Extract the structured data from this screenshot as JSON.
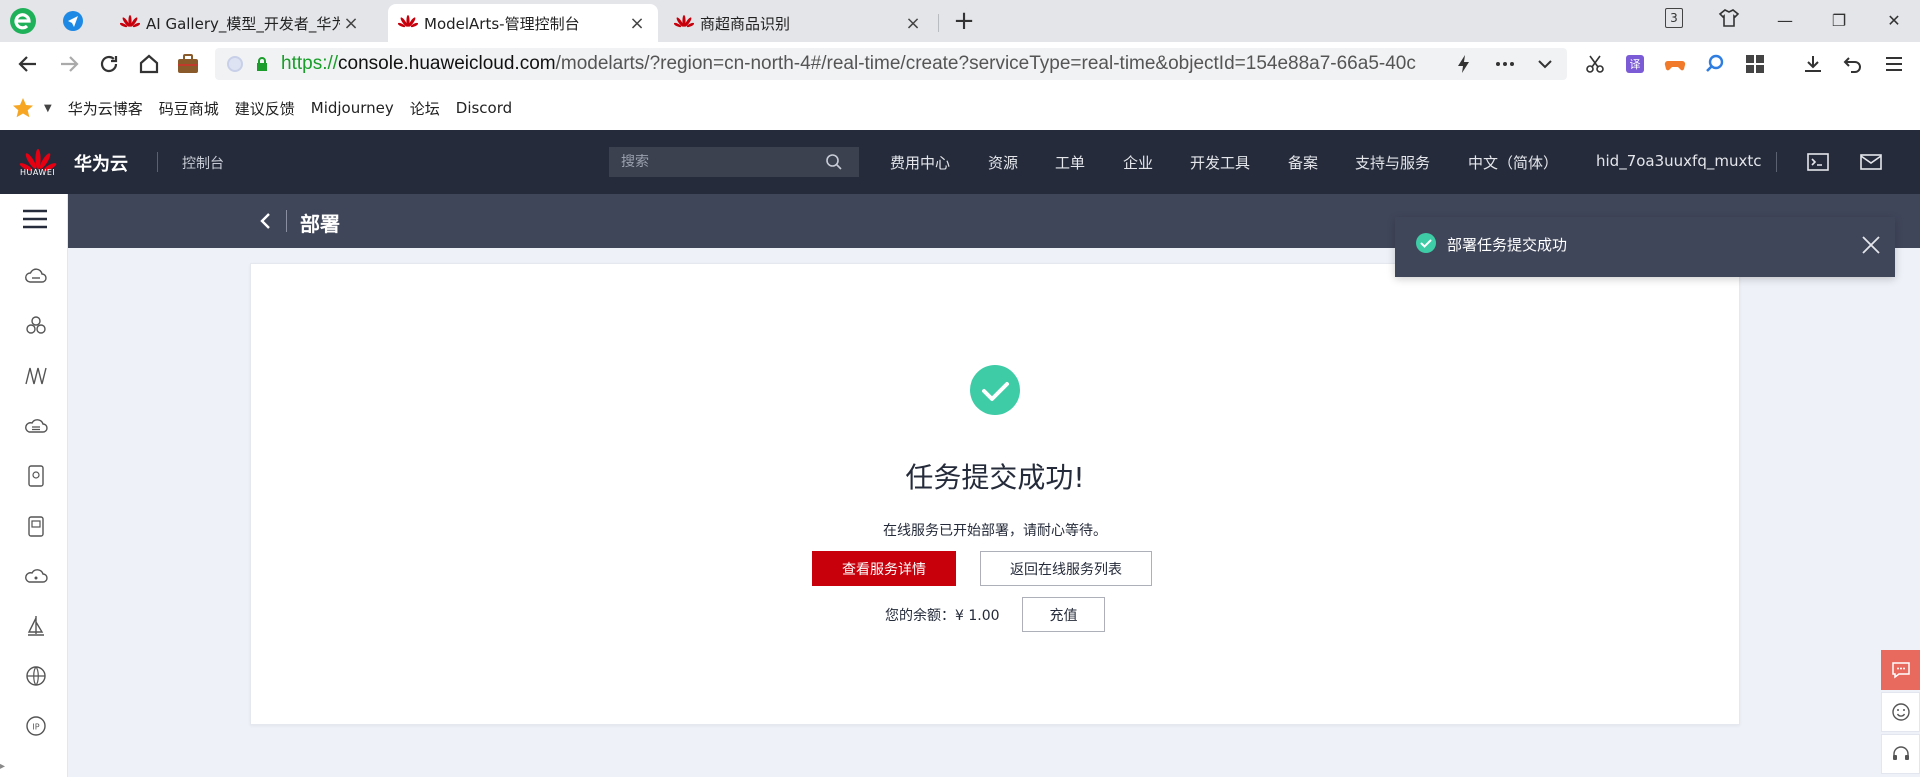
{
  "browser": {
    "tabs": [
      {
        "title": "AI Gallery_模型_开发者_华为云",
        "close": "×"
      },
      {
        "title": "ModelArts-管理控制台",
        "close": "×"
      },
      {
        "title": "商超商品识别",
        "close": "×"
      }
    ],
    "new_tab": "+",
    "tab_count": "3",
    "window_controls": {
      "minimize": "—",
      "restore": "❐",
      "close": "✕"
    },
    "url": {
      "scheme": "https://",
      "host": "console.huaweicloud.com",
      "path": "/modelarts/?region=cn-north-4#/real-time/create?serviceType=real-time&objectId=154e88a7-66a5-40c"
    },
    "bookmarks": [
      "华为云博客",
      "码豆商城",
      "建议反馈",
      "Midjourney",
      "论坛",
      "Discord"
    ]
  },
  "header": {
    "brand": "华为云",
    "logo_text": "HUAWEI",
    "console": "控制台",
    "search_placeholder": "搜索",
    "nav": [
      "费用中心",
      "资源",
      "工单",
      "企业",
      "开发工具",
      "备案",
      "支持与服务",
      "中文（简体）",
      "hid_7oa3uuxfq_muxtc"
    ]
  },
  "page": {
    "title": "部署"
  },
  "result": {
    "title": "任务提交成功!",
    "description": "在线服务已开始部署，请耐心等待。",
    "primary_button": "查看服务详情",
    "secondary_button": "返回在线服务列表",
    "balance_label": "您的余额：",
    "balance_value": "¥  1.00",
    "recharge_button": "充值"
  },
  "toast": {
    "message": "部署任务提交成功"
  },
  "colors": {
    "brand_red": "#c7000b",
    "header_bg": "#252b3a",
    "titlebar_bg": "#40465a",
    "success_green": "#3dcca6"
  }
}
